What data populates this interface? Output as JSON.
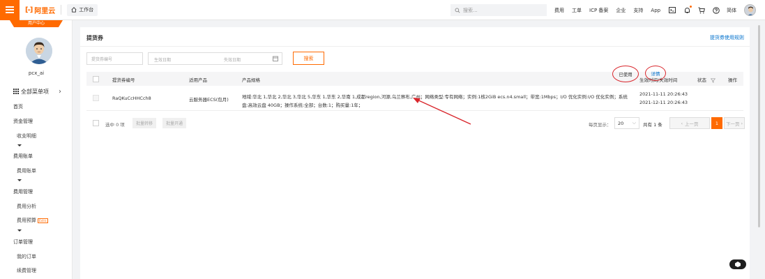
{
  "topbar": {
    "logo_text": "阿里云",
    "workbench_label": "工作台",
    "search_placeholder": "搜索...",
    "links": [
      "费用",
      "工单",
      "ICP 备案",
      "企业",
      "支持",
      "App"
    ],
    "language": "简体"
  },
  "sidebar": {
    "user_center_label": "用户中心",
    "username": "pcx_ai",
    "all_menu_label": "全部菜单项",
    "items": [
      {
        "label": "首页",
        "level": "top"
      },
      {
        "label": "资金管理",
        "level": "top"
      },
      {
        "label": "收支明细",
        "level": "sub"
      },
      {
        "label": "费用账单",
        "level": "top"
      },
      {
        "label": "费用账单",
        "level": "sub"
      },
      {
        "label": "费用管理",
        "level": "top"
      },
      {
        "label": "费用分析",
        "level": "sub"
      },
      {
        "label": "费用预算",
        "level": "sub",
        "badge": "Extra"
      },
      {
        "label": "订单管理",
        "level": "top"
      },
      {
        "label": "我的订单",
        "level": "sub"
      },
      {
        "label": "续费管理",
        "level": "sub"
      }
    ]
  },
  "panel": {
    "title": "提货券",
    "rules_link": "提货券使用规则",
    "filters": {
      "code_placeholder": "提货券编号",
      "start_date_placeholder": "生效日期",
      "end_date_placeholder": "失效日期",
      "search_button": "搜索"
    },
    "table": {
      "headers": [
        "提货券编号",
        "适用产品",
        "产品规格",
        "生效时间/失效时间",
        "状态",
        "操作"
      ],
      "rows": [
        {
          "code": "RaQKuCcHHCch8",
          "product": "云服务器ECS(包月)",
          "spec": "地域:华北 1,华北 2,华北 3,华北 5,华东 1,华东 2,华南 1,成都region,河源,乌兰察布,广州；网络类型:专有网络；实例:1核2GiB ecs.n4.small；带宽:1Mbps；I/O 优化实例:I/O 优化实例；系统盘:高效云盘 40GB；操作系统:全部；台数:1；购买量:1年；",
          "start_time": "2021-11-11 20:26:43",
          "end_time": "2021-12-11 20:26:43",
          "status": "已使用",
          "action": "详情"
        }
      ]
    },
    "footer": {
      "selected_text": "选中 0 项",
      "batch_transfer": "批量转移",
      "batch_activate": "批量开通",
      "page_size_label": "每页显示：",
      "page_size": "20",
      "total_text": "共有 1 条",
      "prev": "上一页",
      "current_page": "1",
      "next": "下一页"
    }
  },
  "colors": {
    "brand": "#ff6a00",
    "link": "#0070cc",
    "annotation": "#d9262c"
  }
}
